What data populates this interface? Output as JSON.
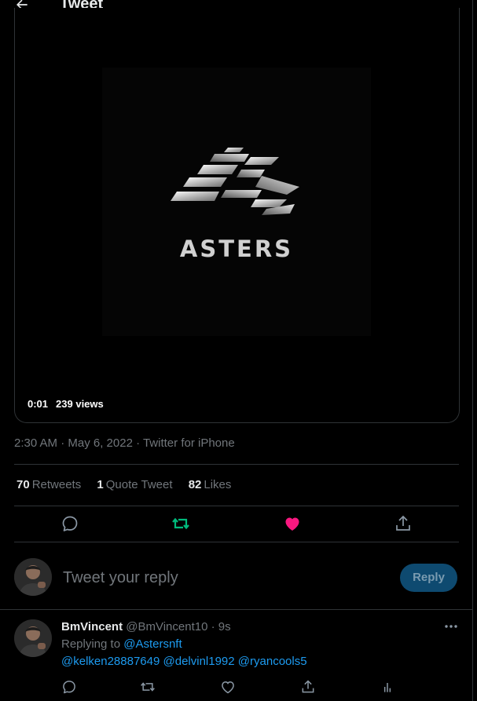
{
  "header": {
    "title": "Tweet",
    "back_icon": "arrow-left-icon"
  },
  "media": {
    "brand_text": "ASTERS",
    "time": "0:01",
    "views": "239 views"
  },
  "meta": {
    "timestamp": "2:30 AM · May 6, 2022 · Twitter for iPhone"
  },
  "stats": {
    "retweets_count": "70",
    "retweets_label": "Retweets",
    "quotes_count": "1",
    "quotes_label": "Quote Tweet",
    "likes_count": "82",
    "likes_label": "Likes"
  },
  "actions": {
    "icons": [
      "reply-icon",
      "retweet-icon",
      "like-icon",
      "share-icon"
    ],
    "retweet_color": "#00ba7c",
    "like_color": "#f91880"
  },
  "reply_box": {
    "placeholder": "Tweet your reply",
    "button_label": "Reply"
  },
  "reply_tweet": {
    "display_name": "BmVincent",
    "handle": "@BmVincent10",
    "separator": "·",
    "time": "9s",
    "replying_to_label": "Replying to",
    "replying_to": "@Astersnft",
    "mentions": [
      "@kelken28887649",
      "@delvinl1992",
      "@ryancools5"
    ]
  },
  "colors": {
    "accent": "#1d9bf0",
    "muted": "#71767b",
    "border": "#2f3336"
  }
}
